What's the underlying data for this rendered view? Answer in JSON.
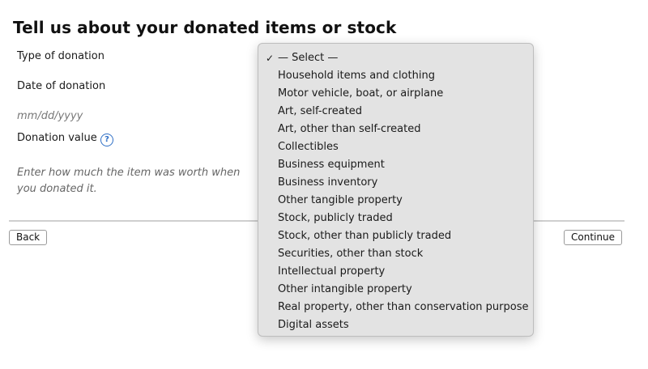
{
  "page": {
    "title": "Tell us about your donated items or stock"
  },
  "form": {
    "type_label": "Type of donation",
    "date_label": "Date of donation",
    "date_placeholder": "mm/dd/yyyy",
    "value_label": "Donation value",
    "value_help_icon": "question-circle-icon",
    "value_hint": "Enter how much the item was worth when you donated it."
  },
  "dropdown": {
    "selected": "— Select —",
    "check_glyph": "✓",
    "options": [
      "— Select —",
      "Household items and clothing",
      "Motor vehicle, boat, or airplane",
      "Art, self-created",
      "Art, other than self-created",
      "Collectibles",
      "Business equipment",
      "Business inventory",
      "Other tangible property",
      "Stock, publicly traded",
      "Stock, other than publicly traded",
      "Securities, other than stock",
      "Intellectual property",
      "Other intangible property",
      "Real property, other than conservation purpose",
      "Digital assets"
    ]
  },
  "nav": {
    "back_label": "Back",
    "continue_label": "Continue"
  },
  "colors": {
    "help_icon": "#2f6fc6",
    "dropdown_bg": "#e3e3e3",
    "divider": "#cfcfcf"
  }
}
